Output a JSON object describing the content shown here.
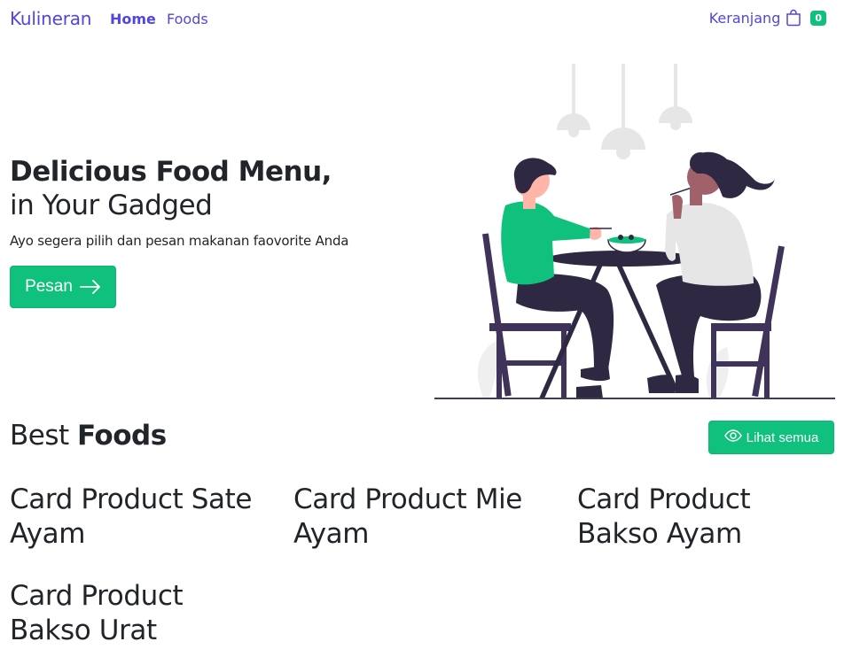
{
  "navbar": {
    "brand": "Kulineran",
    "links": [
      "Home",
      "Foods"
    ],
    "cart_label": "Keranjang",
    "cart_count": "0",
    "cart_icon": "shopping-bag-icon"
  },
  "hero": {
    "title": "Delicious Food Menu,",
    "subtitle": "in Your Gadged",
    "description": "Ayo segera pilih dan pesan makanan faovorite Anda",
    "button_label": "Pesan",
    "button_icon": "arrow-right-icon"
  },
  "best_foods": {
    "title_prefix": "Best",
    "title_bold": "Foods",
    "view_all_label": "Lihat semua",
    "view_all_icon": "eye-icon",
    "cards": [
      "Card Product Sate Ayam",
      "Card Product Mie Ayam",
      "Card Product Bakso Ayam",
      "Card Product Bakso Urat"
    ]
  },
  "colors": {
    "primary": "#4f46e5",
    "success": "#10c17d",
    "text": "#212529",
    "illustration_dark": "#2f2843",
    "illustration_green": "#10c17d"
  }
}
